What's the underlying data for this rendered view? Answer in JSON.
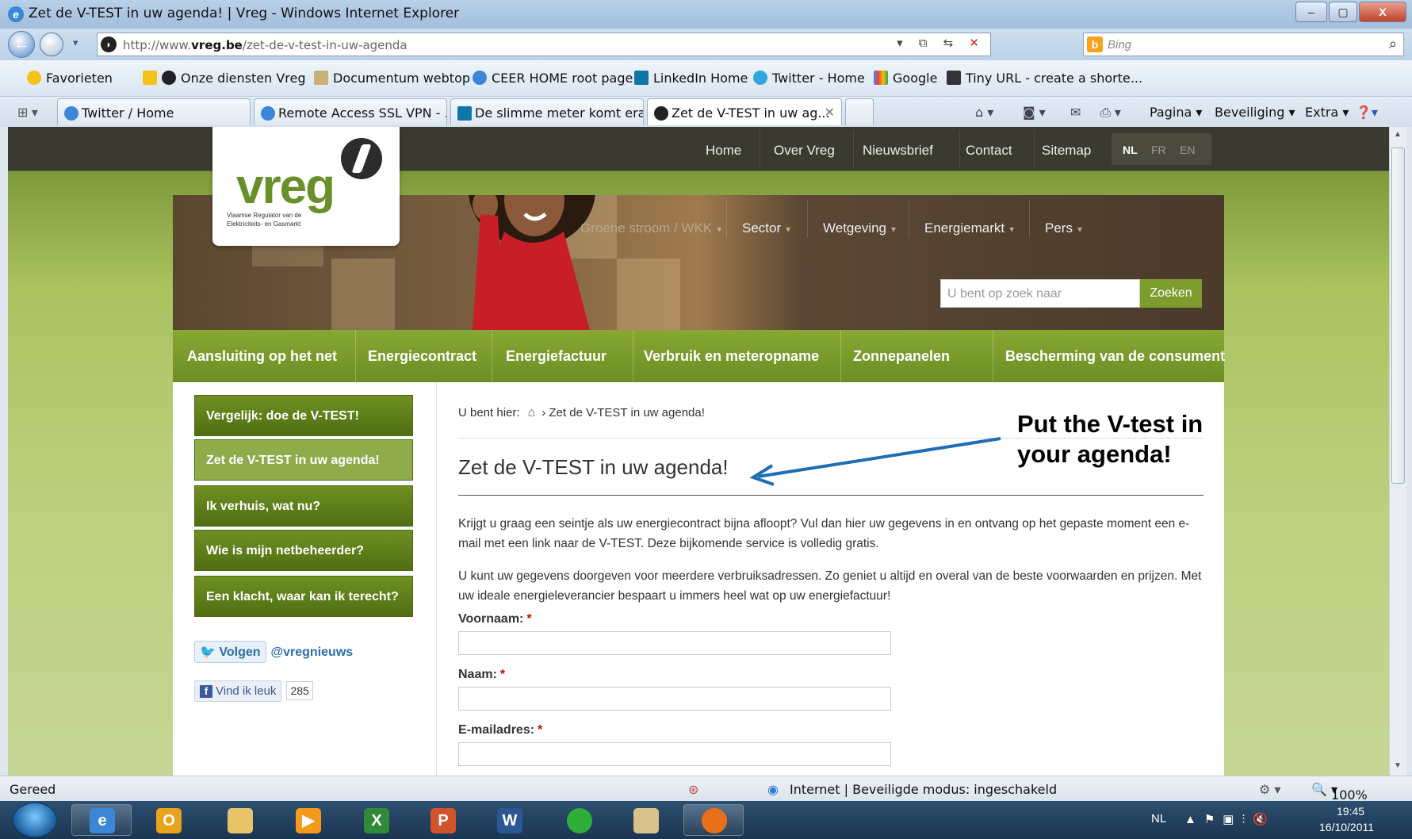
{
  "window": {
    "title": "Zet de V-TEST in uw agenda! | Vreg - Windows Internet Explorer",
    "buttons": [
      "–",
      "▢",
      "X"
    ]
  },
  "address": {
    "url_prefix": "http://www.",
    "url_domain": "vreg.be",
    "url_path": "/zet-de-v-test-in-uw-agenda",
    "search_placeholder": "Bing"
  },
  "favorites": {
    "label": "Favorieten",
    "items": [
      "Onze diensten  Vreg",
      "Documentum webtop",
      "CEER HOME root page",
      "LinkedIn Home",
      "Twitter - Home",
      "Google",
      "Tiny URL - create a shorte..."
    ]
  },
  "tabs": [
    {
      "label": "Twitter / Home",
      "active": false
    },
    {
      "label": "Remote Access SSL VPN - ...",
      "active": false
    },
    {
      "label": "De slimme meter komt era...",
      "active": false
    },
    {
      "label": "Zet de V-TEST in uw ag...",
      "active": true
    }
  ],
  "commands": [
    "Pagina ▾",
    "Beveiliging ▾",
    "Extra ▾"
  ],
  "site": {
    "topnav": [
      "Home",
      "Over Vreg",
      "Nieuwsbrief",
      "Contact",
      "Sitemap"
    ],
    "languages": [
      "NL",
      "FR",
      "EN"
    ],
    "logo_text": "vreg",
    "logo_sub": "Vlaamse Regulator van de Elektriciteits- en Gasmarkt",
    "mainnav": [
      "Groene stroom / WKK",
      "Sector",
      "Wetgeving",
      "Energiemarkt",
      "Pers"
    ],
    "search_placeholder": "U bent op zoek naar",
    "search_button": "Zoeken",
    "greennav": [
      "Aansluiting op het net",
      "Energiecontract",
      "Energiefactuur",
      "Verbruik en meteropname",
      "Zonnepanelen",
      "Bescherming van de consument"
    ],
    "sidebar": [
      "Vergelijk: doe de V-TEST!",
      "Zet de V-TEST in uw agenda!",
      "Ik verhuis, wat nu?",
      "Wie is mijn netbeheerder?",
      "Een klacht, waar kan ik terecht?"
    ],
    "twitter_button": "Volgen",
    "twitter_handle": "@vregnieuws",
    "facebook_button": "Vind ik leuk",
    "facebook_count": "285",
    "breadcrumb_label": "U bent hier:",
    "breadcrumb_current": "Zet de V-TEST in uw agenda!",
    "heading": "Zet de V-TEST in uw agenda!",
    "para1": "Krijgt u graag een seintje als uw energiecontract bijna afloopt? Vul dan hier uw gegevens in en ontvang op het gepaste moment een e-mail met een link naar de V-TEST. Deze bijkomende service is volledig gratis.",
    "para2": "U kunt uw gegevens doorgeven voor meerdere verbruiksadressen. Zo geniet u altijd en overal van de beste voorwaarden en prijzen. Met uw ideale energieleverancier bespaart u immers heel wat op uw energiefactuur!",
    "fields": [
      "Voornaam:",
      "Naam:",
      "E-mailadres:"
    ],
    "required_mark": "*"
  },
  "annotation": "Put the V-test in your agenda!",
  "statusbar": {
    "left": "Gereed",
    "zone": "Internet | Beveiligde modus: ingeschakeld",
    "zoom": "100%"
  },
  "taskbar": {
    "lang": "NL",
    "time": "19:45",
    "date": "16/10/2011"
  },
  "colors": {
    "brand_green": "#6d8d24",
    "annotation_arrow": "#1f6db5"
  }
}
